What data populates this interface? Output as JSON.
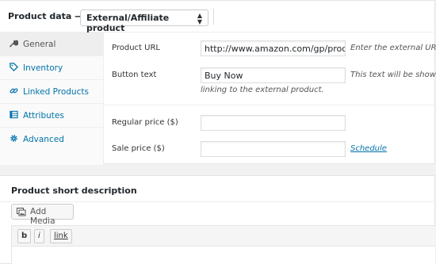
{
  "product_data": {
    "title": "Product data —",
    "product_type": "External/Affiliate product"
  },
  "tabs": [
    {
      "label": "General",
      "icon": "wrench-icon",
      "active": true
    },
    {
      "label": "Inventory",
      "icon": "tag-icon",
      "active": false
    },
    {
      "label": "Linked Products",
      "icon": "link-icon",
      "active": false
    },
    {
      "label": "Attributes",
      "icon": "list-icon",
      "active": false
    },
    {
      "label": "Advanced",
      "icon": "gear-icon",
      "active": false
    }
  ],
  "general": {
    "product_url_label": "Product URL",
    "product_url_value": "http://www.amazon.com/gp/product",
    "product_url_help": "Enter the external URL t",
    "button_text_label": "Button text",
    "button_text_value": "Buy Now",
    "button_text_help_line1": "This text will be shown",
    "button_text_help_line2": "linking to the external product.",
    "regular_price_label": "Regular price ($)",
    "regular_price_value": "",
    "sale_price_label": "Sale price ($)",
    "sale_price_value": "",
    "schedule_link": "Schedule"
  },
  "short_description": {
    "title": "Product short description",
    "add_media": "Add Media",
    "quicktags": [
      "b",
      "i",
      "link"
    ]
  },
  "colors": {
    "link": "#0073aa",
    "active_tab_bg": "#eeeeee"
  }
}
